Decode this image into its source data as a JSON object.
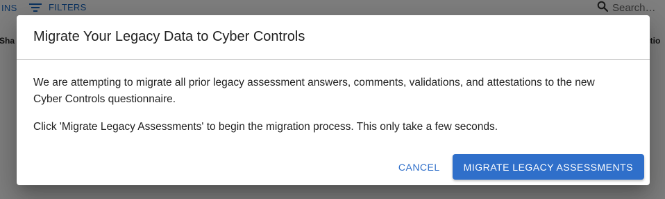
{
  "background": {
    "toolbar": {
      "columns_label": "INS",
      "filters_label": "FILTERS",
      "search_placeholder": "Search…"
    },
    "table": {
      "header_left": "Sha",
      "header_right": "ctio"
    }
  },
  "dialog": {
    "title": "Migrate Your Legacy Data to Cyber Controls",
    "paragraph_1": "We are attempting to migrate all prior legacy assessment answers, comments, validations, and attestations to the new Cyber Controls questionnaire.",
    "paragraph_2": "Click 'Migrate Legacy Assessments' to begin the migration process. This only take a few seconds.",
    "cancel_label": "CANCEL",
    "confirm_label": "MIGRATE LEGACY ASSESSMENTS"
  },
  "colors": {
    "accent": "#2f6fca",
    "backdrop": "rgba(0,0,0,0.5)"
  },
  "icons": {
    "filters": "filter-list-icon",
    "search": "search-icon"
  }
}
